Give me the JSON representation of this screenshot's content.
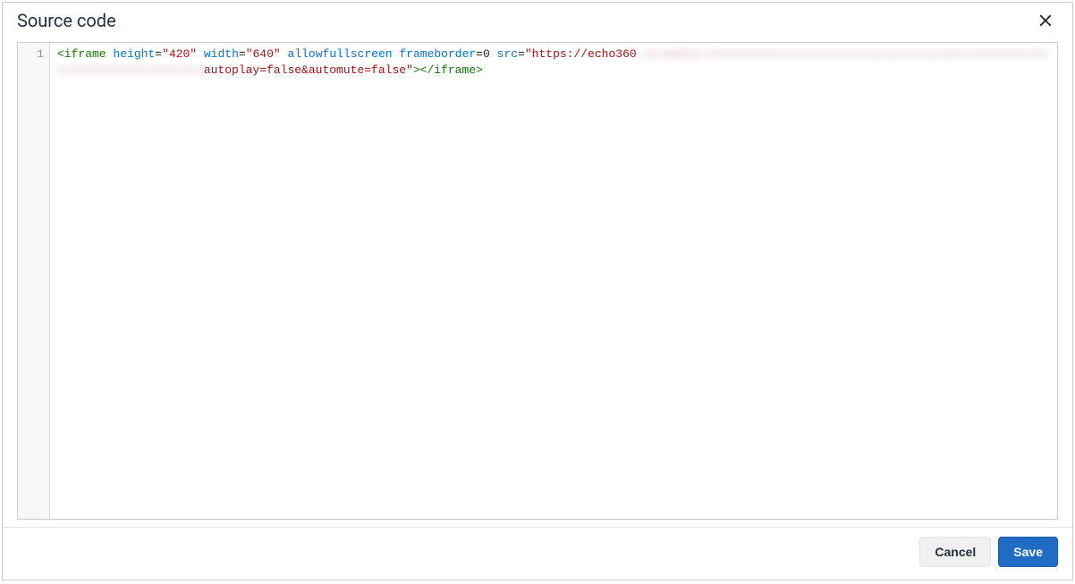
{
  "dialog": {
    "title": "Source code",
    "close_label": "Close"
  },
  "editor": {
    "line_numbers": [
      "1"
    ],
    "tokens": [
      {
        "cls": "tok-tag",
        "text": "<iframe"
      },
      {
        "cls": "",
        "text": " "
      },
      {
        "cls": "tok-attr",
        "text": "height"
      },
      {
        "cls": "tok-op",
        "text": "="
      },
      {
        "cls": "tok-str",
        "text": "\"420\""
      },
      {
        "cls": "",
        "text": " "
      },
      {
        "cls": "tok-attr",
        "text": "width"
      },
      {
        "cls": "tok-op",
        "text": "="
      },
      {
        "cls": "tok-str",
        "text": "\"640\""
      },
      {
        "cls": "",
        "text": " "
      },
      {
        "cls": "tok-attr",
        "text": "allowfullscreen"
      },
      {
        "cls": "",
        "text": " "
      },
      {
        "cls": "tok-attr",
        "text": "frameborder"
      },
      {
        "cls": "tok-op",
        "text": "="
      },
      {
        "cls": "tok-bare",
        "text": "0"
      },
      {
        "cls": "",
        "text": " "
      },
      {
        "cls": "tok-attr",
        "text": "src"
      },
      {
        "cls": "tok-op",
        "text": "="
      },
      {
        "cls": "tok-str",
        "text": "\"https://echo360"
      },
      {
        "cls": "tok-str blurred",
        "text": ".ca/media/xxxxxxxxxxxxxxxxxxxxxxxxxxxxxxxxxxxxxxxxxxxxxxxxxxxxxxxxxxxxxxxxxxxxxx"
      },
      {
        "cls": "tok-str",
        "text": "autoplay=false&automute=false\""
      },
      {
        "cls": "tok-tag",
        "text": "></iframe>"
      }
    ]
  },
  "footer": {
    "cancel_label": "Cancel",
    "save_label": "Save"
  }
}
